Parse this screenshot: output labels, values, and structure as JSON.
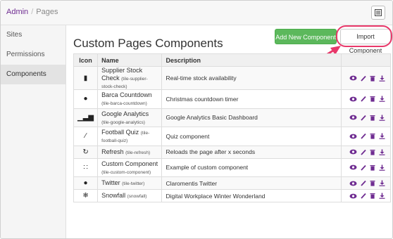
{
  "breadcrumb": {
    "root": "Admin",
    "separator": "/",
    "current": "Pages"
  },
  "sidebar": {
    "items": [
      {
        "label": "Sites",
        "active": false
      },
      {
        "label": "Permissions",
        "active": false
      },
      {
        "label": "Components",
        "active": true
      }
    ]
  },
  "header": {
    "title": "Custom Pages Components",
    "add_button": "Add New Component",
    "import_button": "Import Component"
  },
  "table": {
    "columns": [
      "Icon",
      "Name",
      "Description",
      ""
    ],
    "rows": [
      {
        "icon": "file-icon",
        "glyph": "▮",
        "name": "Supplier Stock Check",
        "slug": "(tile-supplier-stock-check)",
        "description": "Real-time stock availability"
      },
      {
        "icon": "exclamation-circle-icon",
        "glyph": "●",
        "name": "Barca Countdown",
        "slug": "(tile-barca-countdown)",
        "description": "Christmas countdown timer"
      },
      {
        "icon": "bar-chart-icon",
        "glyph": "▁▃▆",
        "name": "Google Analytics",
        "slug": "(tile-google-analytics)",
        "description": "Google Analytics Basic Dashboard"
      },
      {
        "icon": "pencil-icon",
        "glyph": "∕",
        "name": "Football Quiz",
        "slug": "(tile-football-quiz)",
        "description": "Quiz component"
      },
      {
        "icon": "refresh-icon",
        "glyph": "↻",
        "name": "Refresh",
        "slug": "(tile-refresh)",
        "description": "Reloads the page after x seconds"
      },
      {
        "icon": "grid-icon",
        "glyph": "∷",
        "name": "Custom Component",
        "slug": "(tile-custom-component)",
        "description": "Example of custom component"
      },
      {
        "icon": "exclamation-circle-icon",
        "glyph": "●",
        "name": "Twitter",
        "slug": "(tile-twitter)",
        "description": "Claromentis Twitter"
      },
      {
        "icon": "snowflake-icon",
        "glyph": "❄",
        "name": "Snowfall",
        "slug": "(snowfall)",
        "description": "Digital Workplace Winter Wonderland"
      }
    ]
  },
  "colors": {
    "accent": "#6f2c91",
    "add_button": "#5cb85c",
    "highlight": "#e8386a"
  }
}
